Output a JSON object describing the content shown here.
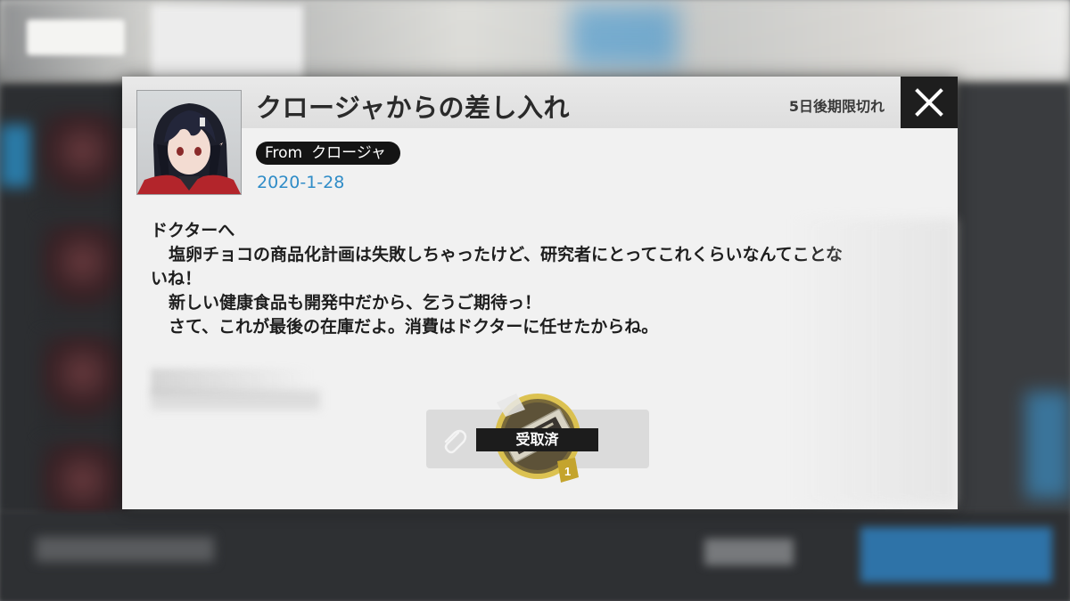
{
  "mail": {
    "title": "クロージャからの差し入れ",
    "expiry": "5日後期限切れ",
    "from_label": "From",
    "sender": "クロージャ",
    "date": "2020-1-28",
    "body": [
      "ドクターへ",
      "塩卵チョコの商品化計画は失敗しちゃったけど、研究者にとってこれくらいなんてことな",
      "いね！",
      "新しい健康食品も開発中だから、乞うご期待っ！",
      "さて、これが最後の在庫だよ。消費はドクターに任せたからね。"
    ]
  },
  "attachment": {
    "status": "受取済",
    "item_count": "1"
  },
  "icons": {
    "close": "close-x-icon",
    "attachment": "paperclip-icon"
  },
  "colors": {
    "date": "#2f8cc7",
    "close_bg": "#1e1e1e",
    "item_ring": "#d4b53a"
  }
}
